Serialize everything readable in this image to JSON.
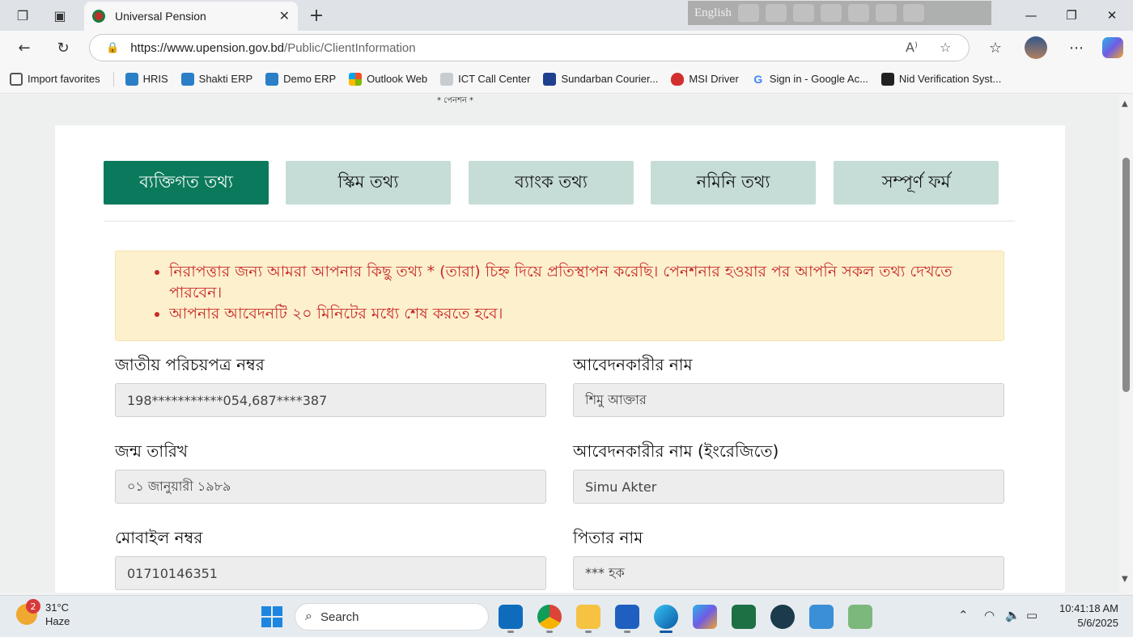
{
  "browser": {
    "tab_title": "Universal Pension",
    "ime_language": "English",
    "url_host": "https://www.upension.gov.bd",
    "url_path": "/Public/ClientInformation"
  },
  "bookmarks": [
    {
      "label": "Import favorites",
      "color": "#555555"
    },
    {
      "label": "HRIS",
      "color": "#2a7fc7"
    },
    {
      "label": "Shakti ERP",
      "color": "#2a7fc7"
    },
    {
      "label": "Demo ERP",
      "color": "#2a7fc7"
    },
    {
      "label": "Outlook Web",
      "color": "#f25022"
    },
    {
      "label": "ICT Call Center",
      "color": "#9aa0a6"
    },
    {
      "label": "Sundarban Courier...",
      "color": "#1f3f8f"
    },
    {
      "label": "MSI Driver",
      "color": "#d32f2f"
    },
    {
      "label": "Sign in - Google Ac...",
      "color": "#4285f4"
    },
    {
      "label": "Nid Verification Syst...",
      "color": "#222222"
    }
  ],
  "page": {
    "logo_caption": "* পেনশন *",
    "steps": [
      {
        "label": "ব্যক্তিগত তথ্য",
        "active": true
      },
      {
        "label": "স্কিম তথ্য",
        "active": false
      },
      {
        "label": "ব্যাংক তথ্য",
        "active": false
      },
      {
        "label": "নমিনি তথ্য",
        "active": false
      },
      {
        "label": "সম্পূর্ণ ফর্ম",
        "active": false
      }
    ],
    "notices": [
      "নিরাপত্তার জন্য আমরা আপনার কিছু তথ্য * (তারা) চিহ্ন দিয়ে প্রতিস্থাপন করেছি। পেনশনার হওয়ার পর আপনি সকল তথ্য দেখতে পারবেন।",
      "আপনার আবেদনটি ২০ মিনিটের মধ্যে শেষ করতে হবে।"
    ],
    "fields": {
      "nid": {
        "label": "জাতীয় পরিচয়পত্র নম্বর",
        "value": "198***********054,687****387"
      },
      "applicant_name": {
        "label": "আবেদনকারীর নাম",
        "value": "শিমু আক্তার"
      },
      "dob": {
        "label": "জন্ম তারিখ",
        "value": "০১ জানুয়ারী ১৯৮৯"
      },
      "applicant_name_en": {
        "label": "আবেদনকারীর নাম (ইংরেজিতে)",
        "value": "Simu Akter"
      },
      "mobile": {
        "label": "মোবাইল নম্বর",
        "value": "01710146351"
      },
      "father_name": {
        "label": "পিতার নাম",
        "value": "*** হক"
      }
    }
  },
  "taskbar": {
    "weather_temp": "31°C",
    "weather_desc": "Haze",
    "weather_badge": "2",
    "search_label": "Search",
    "time": "10:41:18 AM",
    "date": "5/6/2025"
  },
  "colors": {
    "primary": "#0b7a5c",
    "step_inactive": "#c6ddd7",
    "alert_bg": "#fdf0cc",
    "alert_text": "#c62a2a"
  }
}
